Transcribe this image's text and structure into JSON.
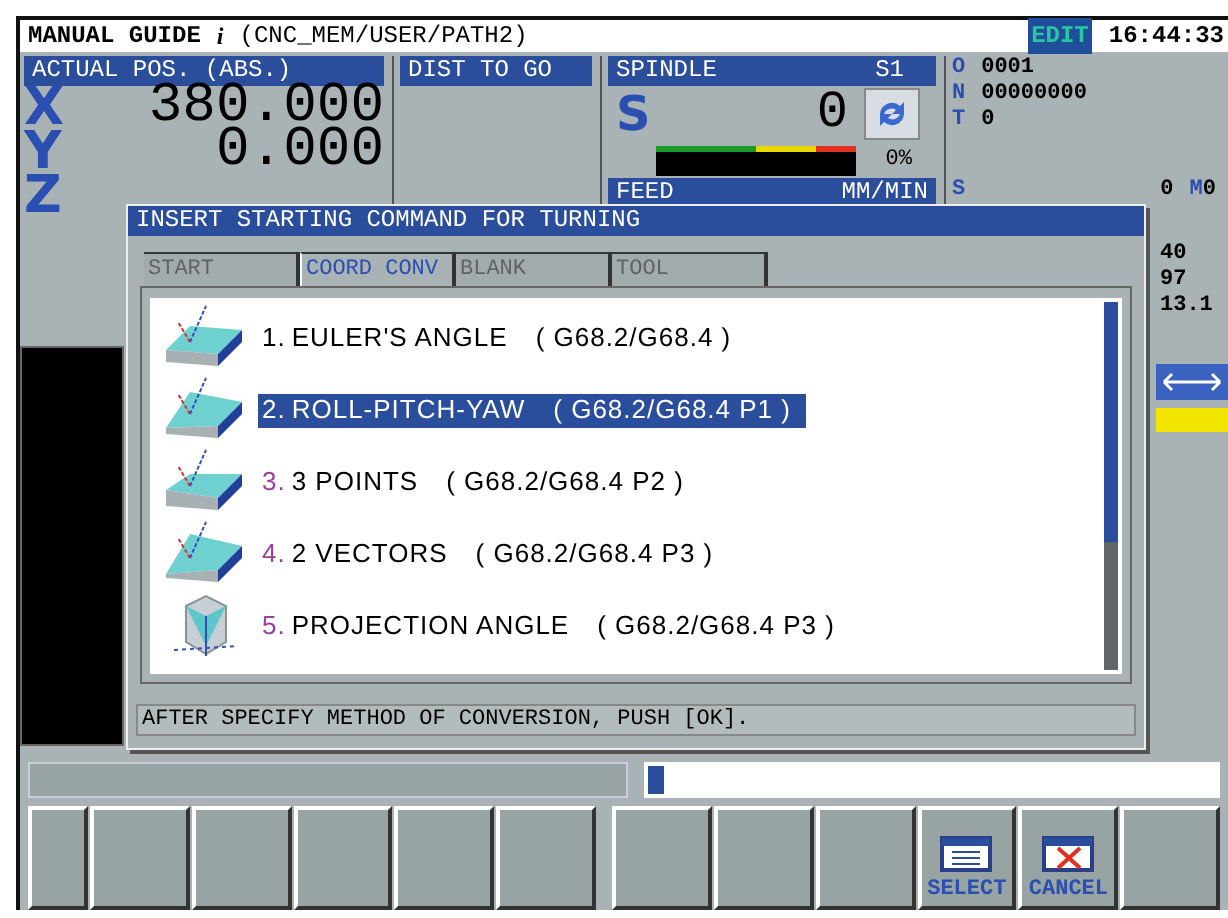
{
  "header": {
    "title": "MANUAL GUIDE",
    "title_mark": "i",
    "path": "(CNC_MEM/USER/PATH2)",
    "mode": "EDIT",
    "time": "16:44:33"
  },
  "position": {
    "title": "ACTUAL POS. (ABS.)",
    "axes": [
      {
        "axis": "X",
        "value": "380.000"
      },
      {
        "axis": "Y",
        "value": "0.000"
      },
      {
        "axis": "Z"
      }
    ]
  },
  "dist_to_go": {
    "title": "DIST TO GO"
  },
  "spindle": {
    "title": "SPINDLE",
    "channel": "S1",
    "letter": "S",
    "value": "0",
    "level": 0,
    "reading": "0%"
  },
  "feed": {
    "title": "FEED",
    "unit": "MM/MIN"
  },
  "program": [
    {
      "label": "O",
      "value": "0001"
    },
    {
      "label": "N",
      "value": "00000000"
    },
    {
      "label": "T",
      "value": "0"
    }
  ],
  "spindle_status": {
    "label": "S",
    "value": "0",
    "m_label": "M",
    "m_value": "0"
  },
  "side_values": [
    "40",
    "97",
    "13.1"
  ],
  "dialog": {
    "title": "INSERT STARTING COMMAND FOR TURNING",
    "tabs": [
      {
        "label": "START",
        "selected": false
      },
      {
        "label": "COORD CONV",
        "selected": true
      },
      {
        "label": "BLANK",
        "selected": false
      },
      {
        "label": "TOOL",
        "selected": false
      }
    ],
    "items": [
      {
        "number": "1.",
        "label": "EULER'S ANGLE",
        "code": "( G68.2/G68.4 )",
        "color": "#000000",
        "selected": false
      },
      {
        "number": "2.",
        "label": "ROLL-PITCH-YAW",
        "code": "( G68.2/G68.4 P1 )",
        "selected": true
      },
      {
        "number": "3.",
        "label": "3 POINTS",
        "code": "( G68.2/G68.4 P2 )",
        "color": "#9b3fa0",
        "selected": false
      },
      {
        "number": "4.",
        "label": "2 VECTORS",
        "code": "( G68.2/G68.4 P3 )",
        "color": "#9b3fa0",
        "selected": false
      },
      {
        "number": "5.",
        "label": "PROJECTION ANGLE",
        "code": "( G68.2/G68.4 P3 )",
        "color": "#9b3fa0",
        "selected": false
      }
    ],
    "message": "AFTER SPECIFY METHOD OF CONVERSION, PUSH [OK]."
  },
  "soft_keys": [
    {
      "kind": "blank"
    },
    {
      "kind": "blank"
    },
    {
      "kind": "blank"
    },
    {
      "kind": "blank"
    },
    {
      "kind": "blank"
    },
    {
      "kind": "blank"
    },
    {
      "kind": "blank"
    },
    {
      "kind": "blank"
    },
    {
      "kind": "blank"
    },
    {
      "kind": "select",
      "label": "SELECT"
    },
    {
      "kind": "cancel",
      "label": "CANCEL"
    },
    {
      "kind": "blank"
    }
  ]
}
